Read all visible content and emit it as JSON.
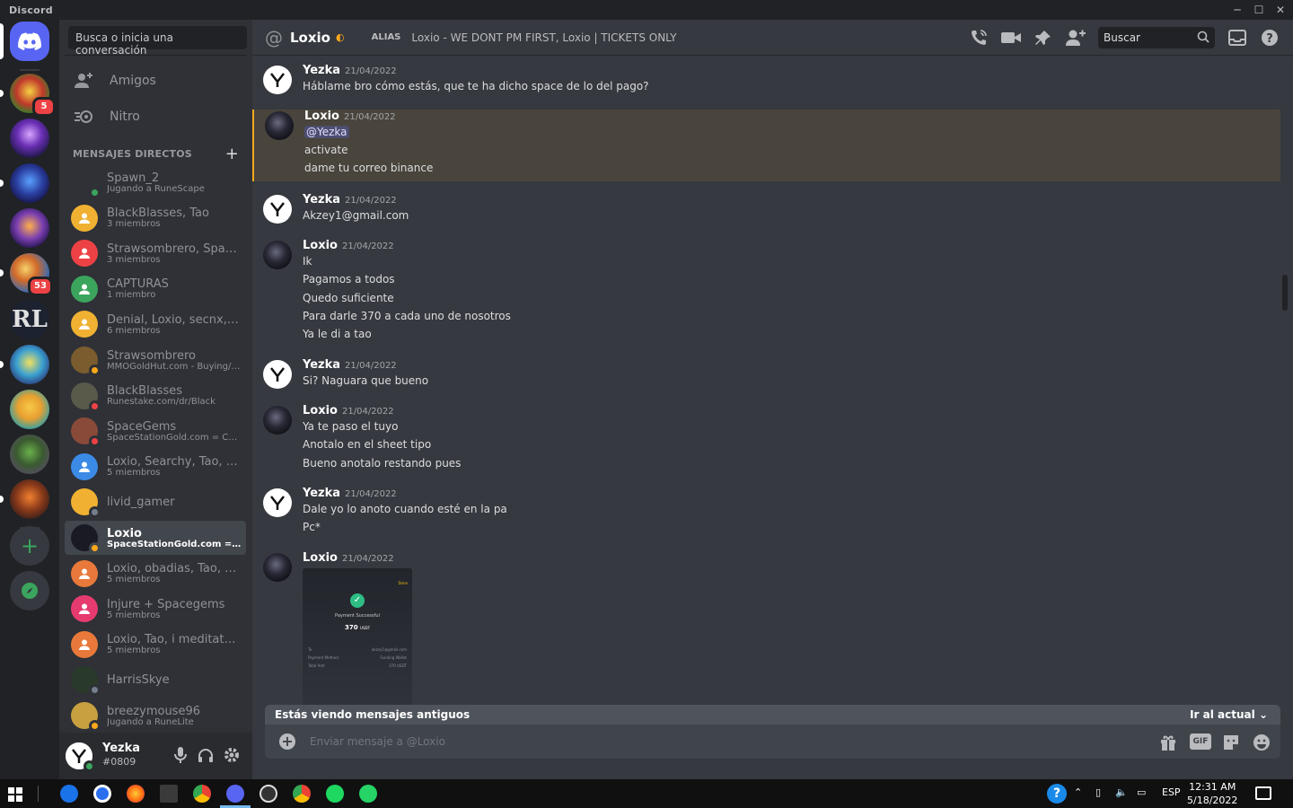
{
  "window": {
    "title": "Discord"
  },
  "guilds": {
    "badges": [
      "5",
      "53"
    ]
  },
  "dm_sidebar": {
    "search_placeholder": "Busca o inicia una conversación",
    "nav": [
      {
        "label": "Amigos"
      },
      {
        "label": "Nitro"
      }
    ],
    "header": "MENSAJES DIRECTOS",
    "items": [
      {
        "name": "Spawn_2",
        "sub": "Jugando a RuneScape",
        "color": "#2f3136",
        "status": "online"
      },
      {
        "name": "BlackBlasses, Tao",
        "sub": "3 miembros",
        "color": "#f0b132",
        "status": ""
      },
      {
        "name": "Strawsombrero, Spaw...",
        "sub": "3 miembros",
        "color": "#ed4245",
        "status": ""
      },
      {
        "name": "CAPTURAS",
        "sub": "1 miembro",
        "color": "#3ba55d",
        "status": ""
      },
      {
        "name": "Denial, Loxio, secnx, T...",
        "sub": "6 miembros",
        "color": "#f0b132",
        "status": ""
      },
      {
        "name": "Strawsombrero",
        "sub": "MMOGoldHut.com - Buying/S...",
        "color": "#7a5c2e",
        "status": "idle"
      },
      {
        "name": "BlackBlasses",
        "sub": "Runestake.com/dr/Black",
        "color": "#5a5a4a",
        "status": "dnd"
      },
      {
        "name": "SpaceGems",
        "sub": "SpaceStationGold.com = CRED...",
        "color": "#8a4a3a",
        "status": "dnd"
      },
      {
        "name": "Loxio, Searchy, Tao, Sp...",
        "sub": "5 miembros",
        "color": "#3b8ae6",
        "status": ""
      },
      {
        "name": "livid_gamer",
        "sub": "",
        "color": "#f0b132",
        "status": "offline"
      },
      {
        "name": "Loxio",
        "sub": "SpaceStationGold.com = CRED...",
        "color": "#1a1a24",
        "status": "idle"
      },
      {
        "name": "Loxio, obadias, Tao, Sp...",
        "sub": "5 miembros",
        "color": "#e8793a",
        "status": ""
      },
      {
        "name": "Injure + Spacegems",
        "sub": "5 miembros",
        "color": "#e63b6f",
        "status": ""
      },
      {
        "name": "Loxio, Tao, i meditate i,...",
        "sub": "5 miembros",
        "color": "#e8793a",
        "status": ""
      },
      {
        "name": "HarrisSkye",
        "sub": "",
        "color": "#2a3a2a",
        "status": "offline"
      },
      {
        "name": "breezymouse96",
        "sub": "Jugando a RuneLite",
        "color": "#c8a040",
        "status": "idle"
      }
    ]
  },
  "user": {
    "name": "Yezka",
    "tag": "#0809"
  },
  "channel": {
    "title": "Loxio",
    "alias_label": "ALIAS",
    "alias": "Loxio - WE DONT PM FIRST, Loxio | TICKETS ONLY",
    "search_placeholder": "Buscar"
  },
  "messages": [
    {
      "author": "Yezka",
      "time": "21/04/2022",
      "lines": [
        "Háblame bro cómo estás, que te ha dicho space de lo del pago?"
      ]
    },
    {
      "author": "Loxio",
      "time": "21/04/2022",
      "mention": "@Yezka",
      "lines": [
        "activate",
        "dame tu correo binance"
      ]
    },
    {
      "author": "Yezka",
      "time": "21/04/2022",
      "lines": [
        "Akzey1@gmail.com"
      ]
    },
    {
      "author": "Loxio",
      "time": "21/04/2022",
      "lines": [
        "Ik",
        "Pagamos a todos",
        "Quedo suficiente",
        "Para darle 370 a cada uno de nosotros",
        "Ya le di a tao"
      ]
    },
    {
      "author": "Yezka",
      "time": "21/04/2022",
      "lines": [
        "Si? Naguara que bueno"
      ]
    },
    {
      "author": "Loxio",
      "time": "21/04/2022",
      "lines": [
        "Ya te paso el tuyo",
        "Anotalo en el sheet tipo",
        "Bueno anotalo restando pues"
      ]
    },
    {
      "author": "Yezka",
      "time": "21/04/2022",
      "lines": [
        "Dale yo lo anoto cuando esté en la pa",
        "Pc*"
      ]
    },
    {
      "author": "Loxio",
      "time": "21/04/2022",
      "lines": []
    }
  ],
  "attachment": {
    "status": "Payment Successful",
    "amount": "370",
    "unit": "USDT",
    "done": "Done",
    "to_label": "To",
    "to_value": "akzey1@gmail.com",
    "method_label": "Payment Method",
    "method_value": "Funding Wallet",
    "total_label": "Total Amt",
    "total_value": "370 USDT"
  },
  "old_messages": {
    "label": "Estás viendo mensajes antiguos",
    "jump": "Ir al actual"
  },
  "composer": {
    "placeholder": "Enviar mensaje a @Loxio",
    "gif": "GIF"
  },
  "taskbar": {
    "lang": "ESP",
    "time": "12:31 AM",
    "date": "5/18/2022"
  },
  "colors": {
    "blurple": "#5865f2",
    "mention_highlight": "#faa81a",
    "online": "#3ba55d",
    "dnd": "#ed4245",
    "idle": "#faa81a"
  }
}
